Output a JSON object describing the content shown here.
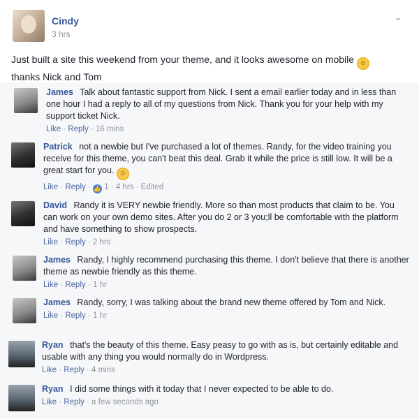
{
  "post": {
    "author": "Cindy",
    "time": "3 hrs",
    "text": "Just built a site this weekend from your theme, and it looks awesome on mobile",
    "text2": "thanks Nick and Tom",
    "emoji": "smile-emoji",
    "chevron": "⌄"
  },
  "actions": {
    "like": "Like",
    "reply": "Reply",
    "sep": " · "
  },
  "comments": [
    {
      "name": "James",
      "text": "Talk about fantastic support from Nick. I sent a email earlier today and in less than one hour I had a reply to all of my questions from Nick. Thank you for your help with my support ticket Nick.",
      "time": "16 mins"
    },
    {
      "name": "Patrick",
      "text": "not a newbie but I've purchased a lot of themes. Randy, for the video training you receive for this theme, you can't beat this deal. Grab it while the price is still low. It will be a great start for you.",
      "likes": "1",
      "time": "4 hrs",
      "edited": "Edited"
    },
    {
      "name": "David",
      "text": "Randy it is VERY newbie friendly. More so than most products that claim to be. You can work on your own demo sites. After you do 2 or 3 you;ll be comfortable with the platform and have something to show prospects.",
      "time": "2 hrs"
    },
    {
      "name": "James",
      "text": "Randy, I highly recommend purchasing this theme. I don't believe that there is another theme as newbie friendly as this theme.",
      "time": "1 hr"
    },
    {
      "name": "James",
      "text": "Randy, sorry, I was talking about the brand new theme offered by Tom and Nick.",
      "time": "1 hr"
    },
    {
      "name": "Ryan",
      "text": "that's the beauty of this theme. Easy peasy to go with as is, but certainly editable and usable with any thing you would normally do in Wordpress.",
      "time": "4 mins"
    },
    {
      "name": "Ryan",
      "text": "I did some things with it today that I never expected to be able to do.",
      "time": "a few seconds ago"
    }
  ]
}
